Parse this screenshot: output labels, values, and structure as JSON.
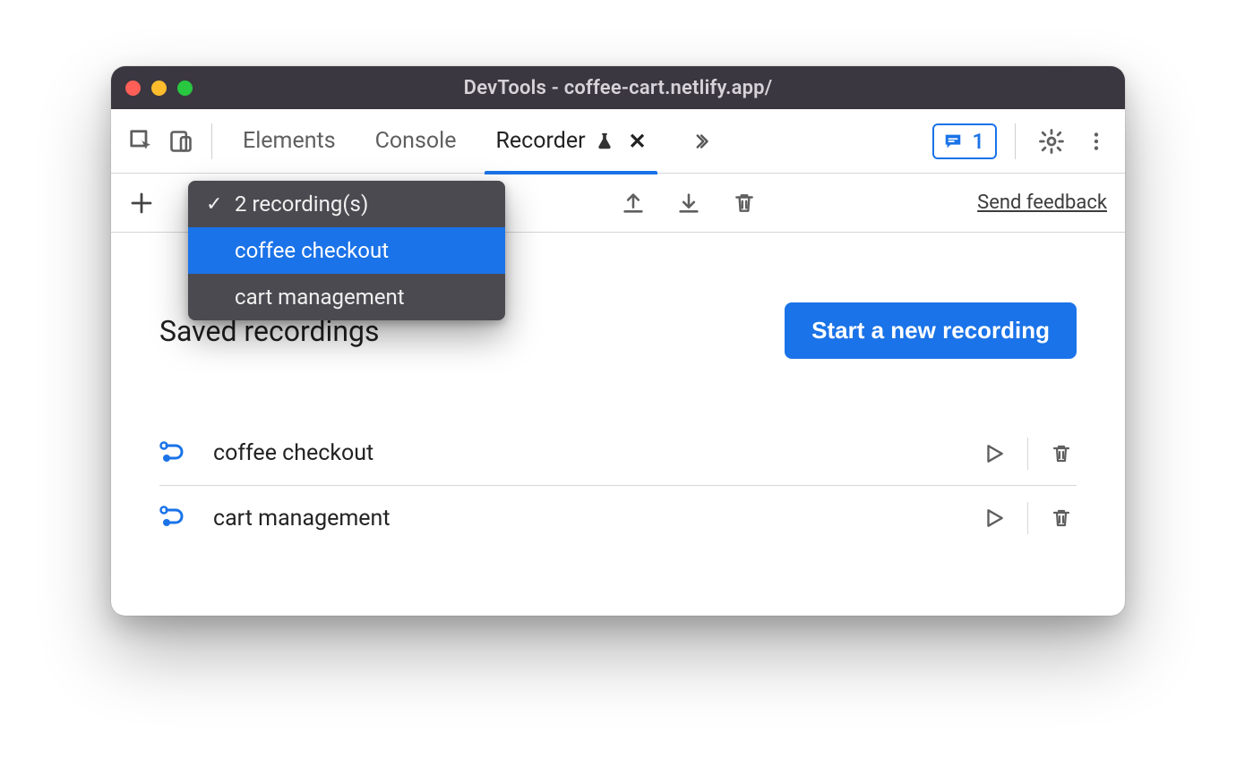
{
  "window": {
    "title": "DevTools - coffee-cart.netlify.app/"
  },
  "tabs": {
    "elements": "Elements",
    "console": "Console",
    "recorder": "Recorder"
  },
  "messages": {
    "count": "1"
  },
  "toolbar": {
    "feedback": "Send feedback"
  },
  "dropdown": {
    "summary": "2 recording(s)",
    "items": [
      "coffee checkout",
      "cart management"
    ]
  },
  "page": {
    "heading": "Saved recordings",
    "start_button": "Start a new recording"
  },
  "recordings": [
    {
      "name": "coffee checkout"
    },
    {
      "name": "cart management"
    }
  ]
}
